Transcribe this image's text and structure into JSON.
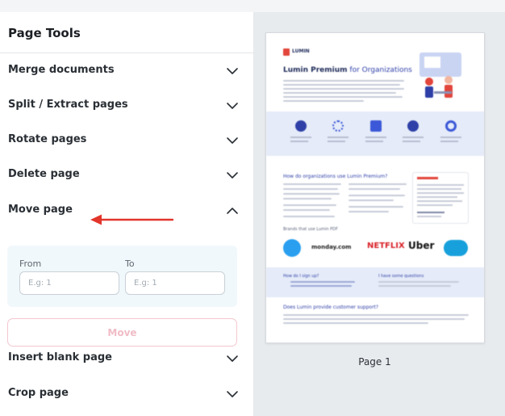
{
  "panel": {
    "title": "Page Tools",
    "tools": [
      {
        "label": "Merge documents",
        "expanded": false,
        "icon": "chevron-down-icon"
      },
      {
        "label": "Split / Extract pages",
        "expanded": false,
        "icon": "chevron-down-icon"
      },
      {
        "label": "Rotate pages",
        "expanded": false,
        "icon": "chevron-down-icon"
      },
      {
        "label": "Delete page",
        "expanded": false,
        "icon": "chevron-down-icon"
      },
      {
        "label": "Move page",
        "expanded": true,
        "icon": "chevron-up-icon"
      },
      {
        "label": "Insert blank page",
        "expanded": false,
        "icon": "chevron-down-icon"
      },
      {
        "label": "Crop page",
        "expanded": false,
        "icon": "chevron-down-icon"
      }
    ],
    "move_form": {
      "from_label": "From",
      "from_placeholder": "E.g: 1",
      "from_value": "",
      "to_label": "To",
      "to_placeholder": "E.g: 1",
      "to_value": "",
      "button_label": "Move"
    },
    "annotation_arrow_icon": "red-arrow-left-icon"
  },
  "preview": {
    "page_label": "Page 1",
    "thumbnail": {
      "brand": "LUMIN",
      "heading_bold": "Lumin Premium",
      "heading_rest": " for Organizations",
      "section_question": "How do organizations use Lumin Premium?",
      "brands_caption": "Brands that use Lumin PDF",
      "brands": [
        "monday.com",
        "NETFLIX",
        "Uber"
      ],
      "signup_heading": "How do I sign up?",
      "questions_heading": "I have some questions",
      "support_heading": "Does Lumin provide customer support?"
    }
  },
  "colors": {
    "accent_red": "#e2352b",
    "move_button_border": "#f3c7cf",
    "form_background": "#f1f8fc"
  }
}
